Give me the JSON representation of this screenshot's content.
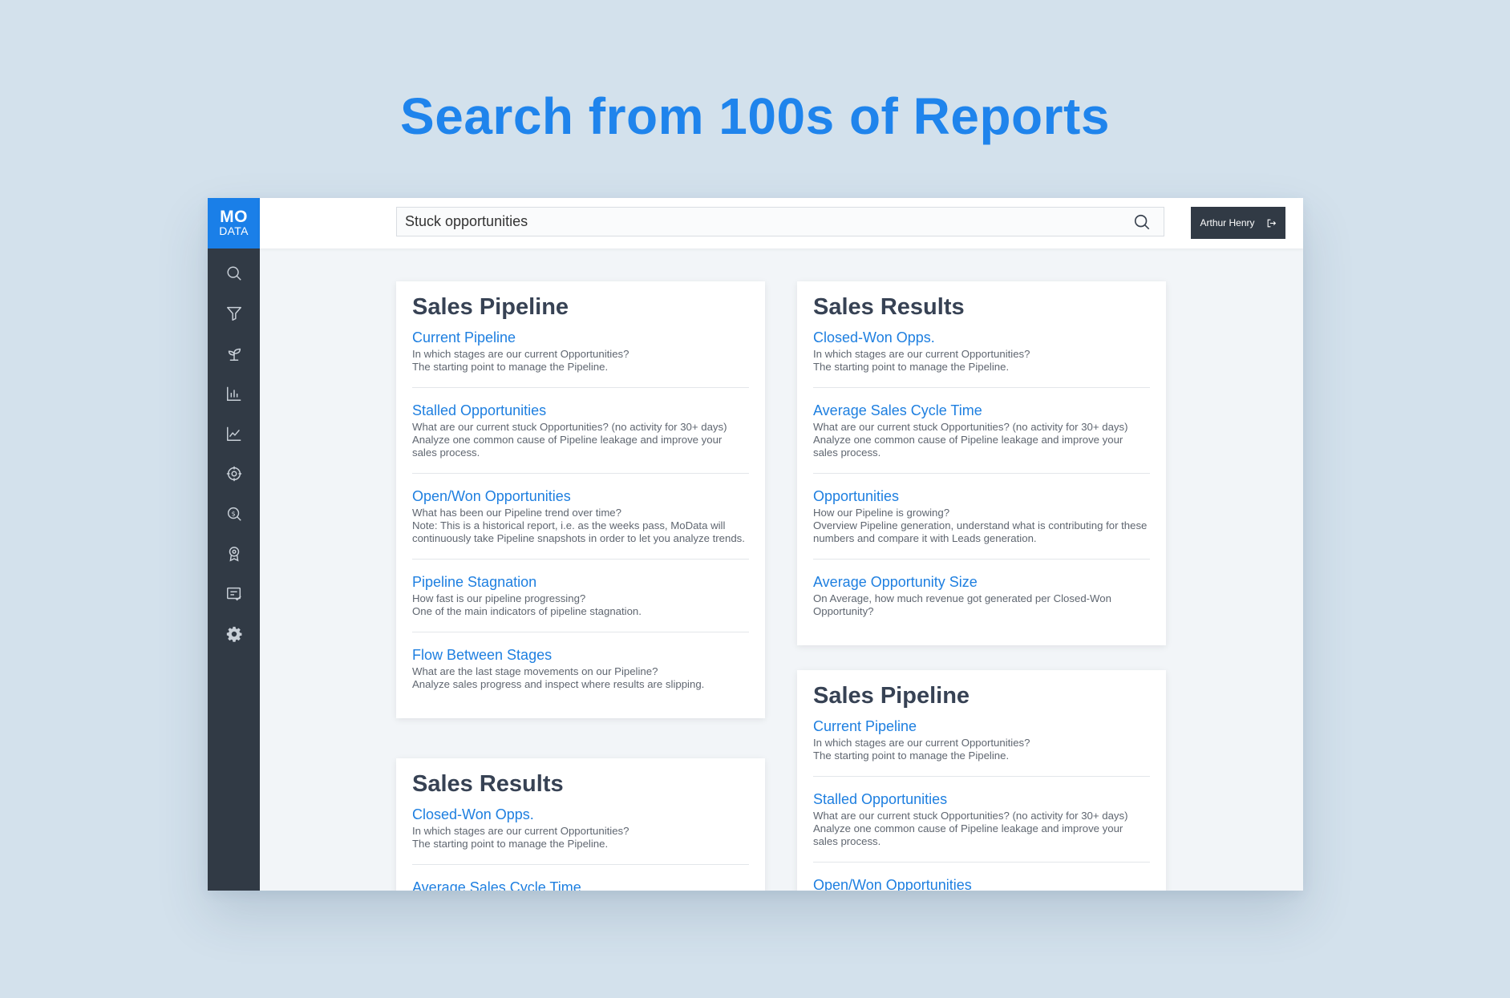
{
  "headline": "Search from 100s of Reports",
  "logo": {
    "top": "MO",
    "bottom": "DATA"
  },
  "sidebar": {
    "items": [
      {
        "icon": "search-icon"
      },
      {
        "icon": "filter-icon"
      },
      {
        "icon": "sprout-icon"
      },
      {
        "icon": "bar-chart-icon"
      },
      {
        "icon": "line-chart-icon"
      },
      {
        "icon": "target-icon"
      },
      {
        "icon": "money-search-icon"
      },
      {
        "icon": "award-icon"
      },
      {
        "icon": "checklist-icon"
      },
      {
        "icon": "gear-icon"
      }
    ]
  },
  "search": {
    "value": "Stuck opportunities",
    "placeholder": ""
  },
  "user": {
    "name": "Arthur Henry"
  },
  "colors": {
    "accent": "#1a7fe8",
    "sidebar": "#313a45",
    "link": "#1e7fe0",
    "headline": "#1f84ec"
  },
  "cards": [
    {
      "title": "Sales Pipeline",
      "reports": [
        {
          "title": "Current Pipeline",
          "desc": "In which stages are our current Opportunities?\nThe starting point to manage the Pipeline."
        },
        {
          "title": "Stalled Opportunities",
          "desc": "What are our current stuck Opportunities? (no activity for 30+ days)\nAnalyze one common cause of Pipeline leakage and improve your sales process."
        },
        {
          "title": "Open/Won Opportunities",
          "desc": "What has been our Pipeline trend over time?\nNote: This is a historical report, i.e. as the weeks pass, MoData will continuously take Pipeline snapshots in order to let you analyze trends."
        },
        {
          "title": "Pipeline Stagnation",
          "desc": "How fast is our pipeline progressing?\nOne of the main indicators of pipeline stagnation."
        },
        {
          "title": "Flow Between Stages",
          "desc": "What are the last stage movements on our Pipeline?\nAnalyze sales progress and inspect where results are slipping."
        }
      ]
    },
    {
      "title": "Sales Results",
      "reports": [
        {
          "title": "Closed-Won Opps.",
          "desc": "In which stages are our current Opportunities?\nThe starting point to manage the Pipeline."
        },
        {
          "title": "Average Sales Cycle Time",
          "desc": "What are our current stuck Opportunities? (no activity for 30+ days)\nAnalyze one common cause of Pipeline leakage and improve your sales process."
        },
        {
          "title": "Opportunities",
          "desc": "How our Pipeline is growing?\nOverview Pipeline generation, understand what is contributing for these numbers and compare it with Leads generation."
        },
        {
          "title": "Average Opportunity Size",
          "desc": "On Average, how much revenue got generated per Closed-Won Opportunity?"
        }
      ]
    },
    {
      "title": "Sales Results",
      "reports": [
        {
          "title": "Closed-Won Opps.",
          "desc": "In which stages are our current Opportunities?\nThe starting point to manage the Pipeline."
        },
        {
          "title": "Average Sales Cycle Time",
          "desc": ""
        }
      ]
    },
    {
      "title": "Sales Pipeline",
      "reports": [
        {
          "title": "Current Pipeline",
          "desc": "In which stages are our current Opportunities?\nThe starting point to manage the Pipeline."
        },
        {
          "title": "Stalled Opportunities",
          "desc": "What are our current stuck Opportunities? (no activity for 30+ days)\nAnalyze one common cause of Pipeline leakage and improve your sales process."
        },
        {
          "title": "Open/Won Opportunities",
          "desc": ""
        }
      ]
    }
  ]
}
